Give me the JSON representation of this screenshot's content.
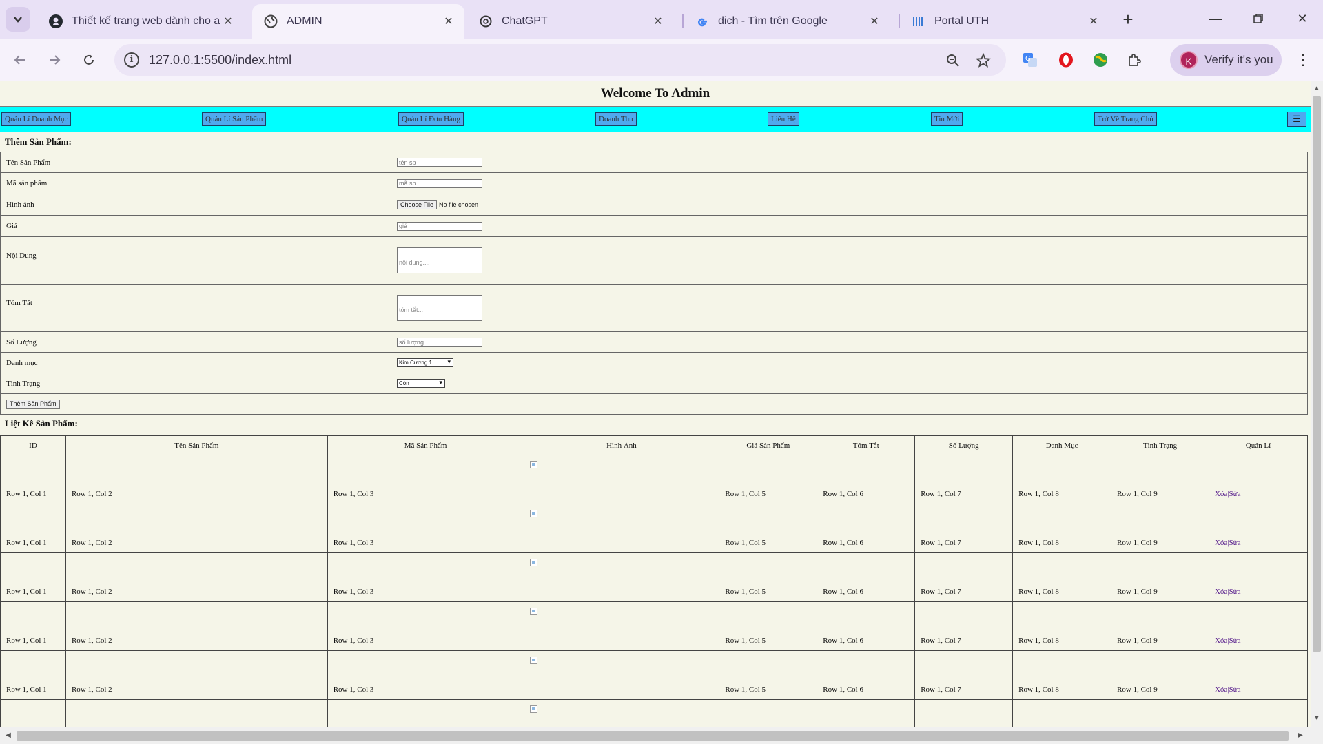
{
  "browser": {
    "tabs": [
      {
        "title": "Thiết kế trang web dành cho adm",
        "icon": "github-icon",
        "active": false
      },
      {
        "title": "ADMIN",
        "icon": "globe-icon",
        "active": true
      },
      {
        "title": "ChatGPT",
        "icon": "chatgpt-icon",
        "active": false
      },
      {
        "title": "dich - Tìm trên Google",
        "icon": "google-icon",
        "active": false
      },
      {
        "title": "Portal UTH",
        "icon": "portal-icon",
        "active": false
      }
    ],
    "url": "127.0.0.1:5500/index.html",
    "profile_label": "Verify it's you",
    "profile_initial": "K",
    "accent": "#e9e1f6"
  },
  "page": {
    "title": "Welcome To Admin",
    "menu": [
      "Quản Lí Doanh Mục",
      "Quản Lí Sản Phẩm",
      "Quản Lí Đơn Hàng",
      "Doanh Thu",
      "Liên Hệ",
      "Tin Mới",
      "Trở Về Trang Chủ"
    ],
    "menu_toggle": "☰",
    "menu_color": "#00ffff",
    "form_title": "Thêm Sản Phẩm:",
    "form": {
      "name_label": "Tên Sản Phẩm",
      "name_placeholder": "tên sp",
      "code_label": "Mã sản phẩm",
      "code_placeholder": "mã sp",
      "image_label": "Hình ảnh",
      "file_button": "Choose File",
      "file_status": "No file chosen",
      "price_label": "Giá",
      "price_placeholder": "giá",
      "content_label": "Nội Dung",
      "content_placeholder": "nội dung....",
      "summary_label": "Tóm Tắt",
      "summary_placeholder": "tóm tắt...",
      "qty_label": "Số Lượng",
      "qty_placeholder": "số lượng",
      "category_label": "Danh mục",
      "category_value": "Kim Cương 1",
      "status_label": "Tình Trạng",
      "status_value": "Còn",
      "submit": "Thêm Sản Phẩm"
    },
    "list_title": "Liệt Kê Sản Phẩm:",
    "columns": [
      "ID",
      "Tên Sản Phẩm",
      "Mã Sản Phẩm",
      "Hình Ảnh",
      "Giá Sản Phẩm",
      "Tóm Tắt",
      "Số Lượng",
      "Danh Mục",
      "Tình Trạng",
      "Quản Lí"
    ],
    "rows": [
      {
        "c1": "Row 1, Col 1",
        "c2": "Row 1, Col 2",
        "c3": "Row 1, Col 3",
        "c5": "Row 1, Col 5",
        "c6": "Row 1, Col 6",
        "c7": "Row 1, Col 7",
        "c8": "Row 1, Col 8",
        "c9": "Row 1, Col 9",
        "delete": "Xóa",
        "sep": "|",
        "edit": "Sửa"
      },
      {
        "c1": "Row 1, Col 1",
        "c2": "Row 1, Col 2",
        "c3": "Row 1, Col 3",
        "c5": "Row 1, Col 5",
        "c6": "Row 1, Col 6",
        "c7": "Row 1, Col 7",
        "c8": "Row 1, Col 8",
        "c9": "Row 1, Col 9",
        "delete": "Xóa",
        "sep": "|",
        "edit": "Sửa"
      },
      {
        "c1": "Row 1, Col 1",
        "c2": "Row 1, Col 2",
        "c3": "Row 1, Col 3",
        "c5": "Row 1, Col 5",
        "c6": "Row 1, Col 6",
        "c7": "Row 1, Col 7",
        "c8": "Row 1, Col 8",
        "c9": "Row 1, Col 9",
        "delete": "Xóa",
        "sep": "|",
        "edit": "Sửa"
      },
      {
        "c1": "Row 1, Col 1",
        "c2": "Row 1, Col 2",
        "c3": "Row 1, Col 3",
        "c5": "Row 1, Col 5",
        "c6": "Row 1, Col 6",
        "c7": "Row 1, Col 7",
        "c8": "Row 1, Col 8",
        "c9": "Row 1, Col 9",
        "delete": "Xóa",
        "sep": "|",
        "edit": "Sửa"
      },
      {
        "c1": "Row 1, Col 1",
        "c2": "Row 1, Col 2",
        "c3": "Row 1, Col 3",
        "c5": "Row 1, Col 5",
        "c6": "Row 1, Col 6",
        "c7": "Row 1, Col 7",
        "c8": "Row 1, Col 8",
        "c9": "Row 1, Col 9",
        "delete": "Xóa",
        "sep": "|",
        "edit": "Sửa"
      },
      {
        "c1": "",
        "c2": "",
        "c3": "",
        "c5": "",
        "c6": "",
        "c7": "",
        "c8": "",
        "c9": "",
        "delete": "",
        "sep": "",
        "edit": ""
      }
    ]
  }
}
